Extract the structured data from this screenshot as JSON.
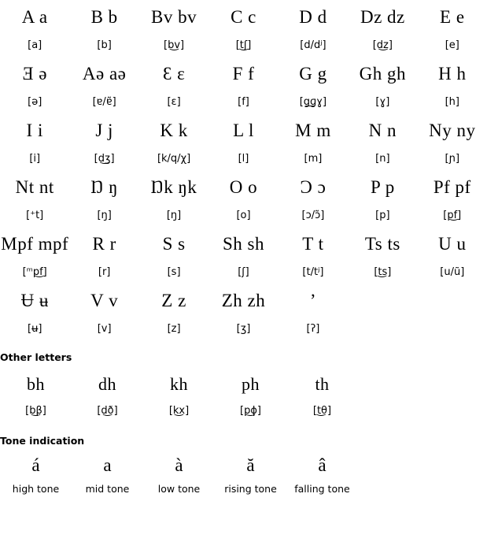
{
  "alphabet": {
    "rows": [
      [
        {
          "letter": "A a",
          "ipa": "[a]"
        },
        {
          "letter": "B b",
          "ipa": "[b]"
        },
        {
          "letter": "Bv bv",
          "ipa": "[b͜v]"
        },
        {
          "letter": "C c",
          "ipa": "[t͜ʃ]"
        },
        {
          "letter": "D d",
          "ipa": "[d/dʲ]"
        },
        {
          "letter": "Dz dz",
          "ipa": "[d͜z]"
        },
        {
          "letter": "E e",
          "ipa": "[e]"
        }
      ],
      [
        {
          "letter": "Ǝ ə",
          "ipa": "[ə]"
        },
        {
          "letter": "Aə aə",
          "ipa": "[ɐ/ɐ̃]"
        },
        {
          "letter": "Ɛ ɛ",
          "ipa": "[ɛ]"
        },
        {
          "letter": "F f",
          "ipa": "[f]"
        },
        {
          "letter": "G g",
          "ipa": "[g͟ɡɣ]"
        },
        {
          "letter": "Gh gh",
          "ipa": "[ɣ]"
        },
        {
          "letter": "H h",
          "ipa": "[h]"
        }
      ],
      [
        {
          "letter": "I i",
          "ipa": "[i]"
        },
        {
          "letter": "J j",
          "ipa": "[d͜ʒ]"
        },
        {
          "letter": "K k",
          "ipa": "[k/q/χ]"
        },
        {
          "letter": "L l",
          "ipa": "[l]"
        },
        {
          "letter": "M m",
          "ipa": "[m]"
        },
        {
          "letter": "N n",
          "ipa": "[n]"
        },
        {
          "letter": "Ny ny",
          "ipa": "[ɲ]"
        }
      ],
      [
        {
          "letter": "Nt nt",
          "ipa": "[⁺t]"
        },
        {
          "letter": "Ŋ ŋ",
          "ipa": "[ŋ]"
        },
        {
          "letter": "Ŋk ŋk",
          "ipa": "[ŋ]"
        },
        {
          "letter": "O o",
          "ipa": "[o]"
        },
        {
          "letter": "Ɔ ɔ",
          "ipa": "[ɔ/ɔ̃]"
        },
        {
          "letter": "P p",
          "ipa": "[p]"
        },
        {
          "letter": "Pf pf",
          "ipa": "[p͜f]"
        }
      ],
      [
        {
          "letter": "Mpf mpf",
          "ipa": "[ᵐp͜f]"
        },
        {
          "letter": "R r",
          "ipa": "[r]"
        },
        {
          "letter": "S s",
          "ipa": "[s]"
        },
        {
          "letter": "Sh sh",
          "ipa": "[ʃ]"
        },
        {
          "letter": "T t",
          "ipa": "[t/tʲ]"
        },
        {
          "letter": "Ts ts",
          "ipa": "[t͜s]"
        },
        {
          "letter": "U u",
          "ipa": "[u/ũ]"
        }
      ],
      [
        {
          "letter": "Ʉ ʉ",
          "ipa": "[ʉ]"
        },
        {
          "letter": "V v",
          "ipa": "[v]"
        },
        {
          "letter": "Z z",
          "ipa": "[z]"
        },
        {
          "letter": "Zh zh",
          "ipa": "[ʒ]"
        },
        {
          "letter": "’",
          "ipa": "[ʔ]"
        },
        {
          "letter": "",
          "ipa": ""
        },
        {
          "letter": "",
          "ipa": ""
        }
      ]
    ]
  },
  "other_letters": {
    "heading": "Other letters",
    "items": [
      {
        "letter": "bh",
        "ipa": "[b͜β]"
      },
      {
        "letter": "dh",
        "ipa": "[d͜ð]"
      },
      {
        "letter": "kh",
        "ipa": "[k͜x]"
      },
      {
        "letter": "ph",
        "ipa": "[p͜ɸ]"
      },
      {
        "letter": "th",
        "ipa": "[t͜θ]"
      }
    ]
  },
  "tone_indication": {
    "heading": "Tone indication",
    "items": [
      {
        "mark": "á",
        "label": "high tone"
      },
      {
        "mark": "a",
        "label": "mid tone"
      },
      {
        "mark": "à",
        "label": "low tone"
      },
      {
        "mark": "ă",
        "label": "rising tone"
      },
      {
        "mark": "â",
        "label": "falling tone"
      }
    ]
  }
}
